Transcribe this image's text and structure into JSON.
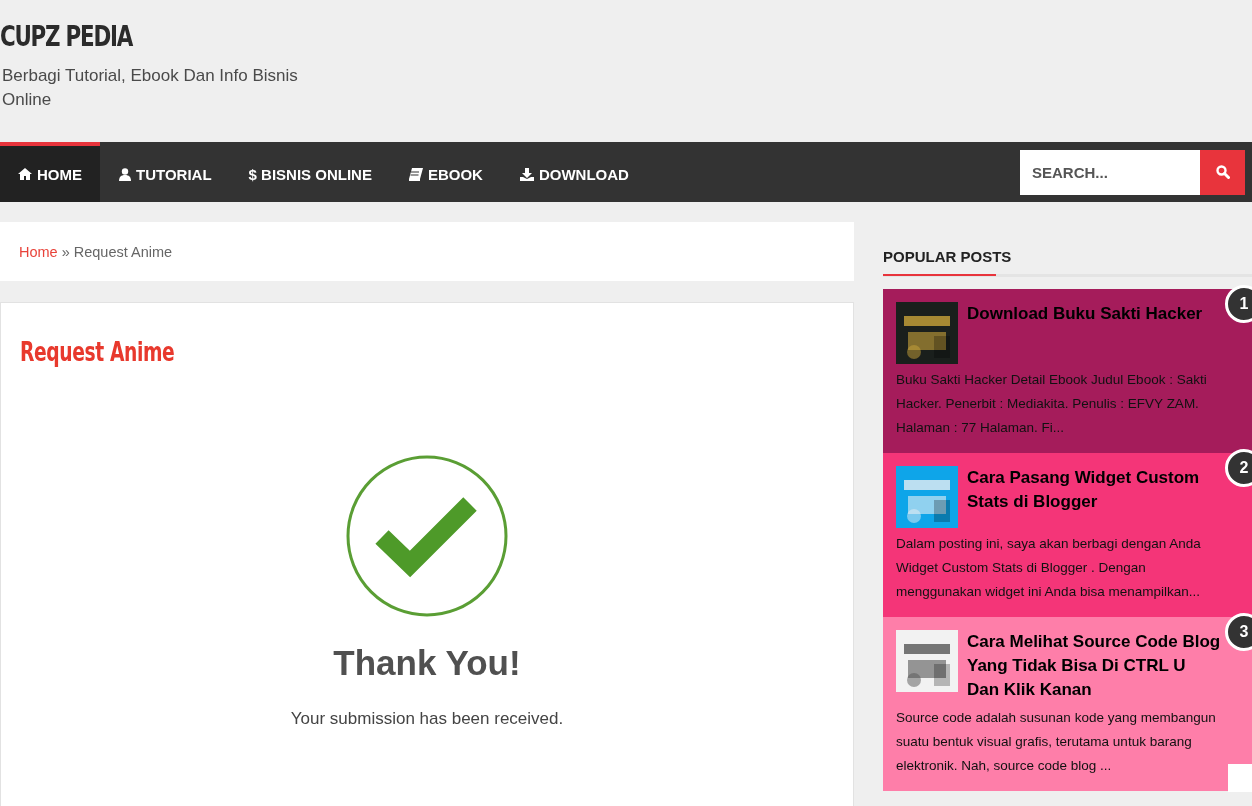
{
  "site": {
    "title": "CUPZ PEDIA",
    "tagline": "Berbagi Tutorial, Ebook Dan Info Bisnis Online"
  },
  "nav": {
    "items": [
      {
        "label": "HOME",
        "kind": "home",
        "selected": true
      },
      {
        "label": "TUTORIAL",
        "kind": "user",
        "selected": false
      },
      {
        "label": "$ BISNIS ONLINE",
        "kind": "plain",
        "selected": false
      },
      {
        "label": "EBOOK",
        "kind": "book",
        "selected": false
      },
      {
        "label": "DOWNLOAD",
        "kind": "download",
        "selected": false
      }
    ],
    "search": {
      "placeholder": "SEARCH..."
    }
  },
  "breadcrumb": {
    "home": "Home",
    "separator": "»",
    "current": "Request Anime"
  },
  "page": {
    "title": "Request Anime",
    "heading": "Thank You!",
    "message": "Your submission has been received."
  },
  "popular_posts": {
    "title": "POPULAR POSTS",
    "posts": [
      {
        "rank": "1",
        "color": "#a51c5b",
        "title": "Download Buku Sakti Hacker",
        "excerpt": "Buku Sakti Hacker Detail Ebook Judul Ebook : Sakti Hacker. Penerbit : Mediakita. Penulis : EFVY ZAM. Halaman : 77 Halaman. Fi..."
      },
      {
        "rank": "2",
        "color": "#f43578",
        "title": "Cara Pasang Widget Custom Stats di Blogger",
        "excerpt": "Dalam posting ini, saya akan berbagi dengan Anda  Widget Custom Stats di Blogger . Dengan menggunakan widget ini Anda bisa menampilkan..."
      },
      {
        "rank": "3",
        "color": "#fe7ea9",
        "title": "Cara Melihat Source Code Blog Yang Tidak Bisa Di CTRL U Dan Klik Kanan",
        "excerpt": "Source code  adalah susunan kode  yang membangun suatu bentuk visual grafis, terutama untuk barang elektronik. Nah, source code  blog  ..."
      }
    ]
  }
}
